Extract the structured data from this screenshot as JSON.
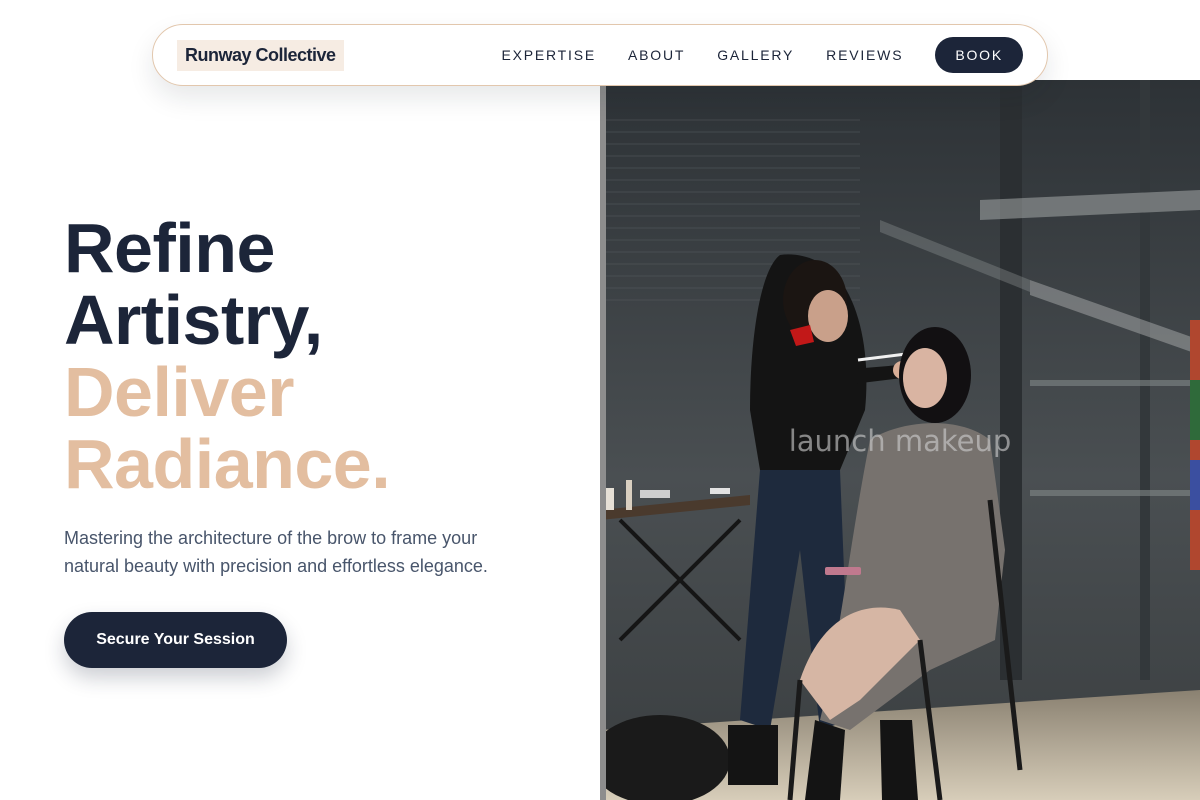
{
  "nav": {
    "brand": "Runway Collective",
    "links": [
      "EXPERTISE",
      "ABOUT",
      "GALLERY",
      "REVIEWS"
    ],
    "cta": "BOOK"
  },
  "hero": {
    "headline": [
      "Refine",
      "Artistry,",
      "Deliver",
      "Radiance."
    ],
    "subtext": "Mastering the architecture of the brow to frame your natural beauty with precision and effortless elegance.",
    "cta": "Secure Your Session",
    "image_caption": "launch makeup"
  },
  "colors": {
    "navy": "#1c2539",
    "accent": "#e3bea0",
    "nav_border": "#e2c7ad",
    "brand_bg": "#f6ece3",
    "body_text": "#48556b"
  }
}
